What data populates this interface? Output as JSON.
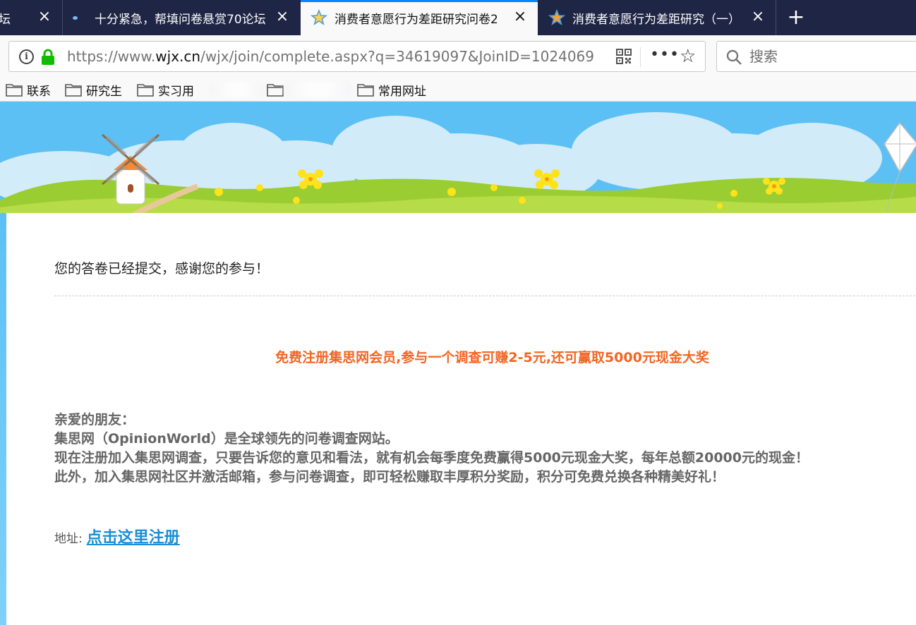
{
  "tabs": [
    {
      "title": "坛",
      "favicon": "none",
      "active": false
    },
    {
      "title": "十分紧急，帮填问卷悬赏70论坛",
      "favicon": "dot-icon",
      "active": false
    },
    {
      "title": "消费者意愿行为差距研究问卷2",
      "favicon": "star-icon",
      "active": true
    },
    {
      "title": "消费者意愿行为差距研究（一）",
      "favicon": "star-icon",
      "active": false
    }
  ],
  "newtab_label": "+",
  "address": {
    "prefix": "https://www.",
    "host": "wjx.cn",
    "path": "/wjx/join/complete.aspx?q=34619097&JoinID=1024069"
  },
  "search": {
    "placeholder": "搜索"
  },
  "bookmarks": [
    {
      "label": "联系"
    },
    {
      "label": "研究生"
    },
    {
      "label": "实习用"
    },
    {
      "label": "常用网址"
    }
  ],
  "page": {
    "thanks": "您的答卷已经提交，感谢您的参与！",
    "promo": "免费注册集思网会员,参与一个调查可赚2-5元,还可赢取5000元现金大奖",
    "greeting": "亲爱的朋友：",
    "line1": "集思网（OpinionWorld）是全球领先的问卷调查网站。",
    "line2": "现在注册加入集思网调查，只要告诉您的意见和看法，就有机会每季度免费赢得5000元现金大奖，每年总额20000元的现金！",
    "line3": "此外，加入集思网社区并激活邮箱，参与问卷调查，即可轻松赚取丰厚积分奖励，积分可免费兑换各种精美好礼！",
    "address_label": "地址:",
    "register_link": "点击这里注册"
  },
  "colors": {
    "tabbar": "#1f2544",
    "accent": "#0a84ff",
    "promo": "#f26522",
    "link": "#1a8fd6",
    "sky": "#5cc0f5",
    "grass": "#9acd32"
  }
}
